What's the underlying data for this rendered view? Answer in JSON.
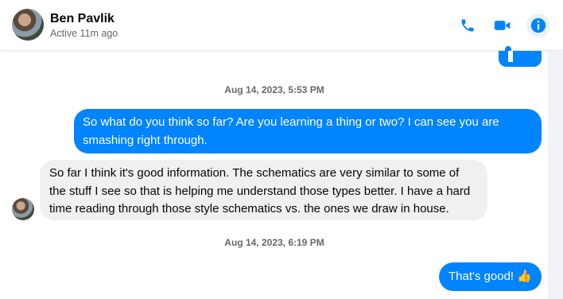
{
  "header": {
    "name": "Ben Pavlik",
    "status": "Active 11m ago"
  },
  "icons": {
    "phone": "phone-icon",
    "video": "video-camera-icon",
    "info": "info-icon"
  },
  "colors": {
    "accent": "#0084ff",
    "incoming_bg": "#f0f0f0",
    "muted": "#65676b"
  },
  "messages": [
    {
      "type": "timestamp",
      "text": "Aug 14, 2023, 5:53 PM"
    },
    {
      "type": "outgoing",
      "text": "So what do you think so far? Are you learning a thing or two? I can see you are smashing right through."
    },
    {
      "type": "incoming",
      "text": "So far I think it's good information. The schematics are very similar to some of the stuff I see so that is helping me understand those types better. I have a hard time reading through those style schematics vs. the ones we draw in house."
    },
    {
      "type": "timestamp",
      "text": "Aug 14, 2023, 6:19 PM"
    },
    {
      "type": "outgoing",
      "text": "That's good!",
      "emoji": "👍"
    }
  ]
}
